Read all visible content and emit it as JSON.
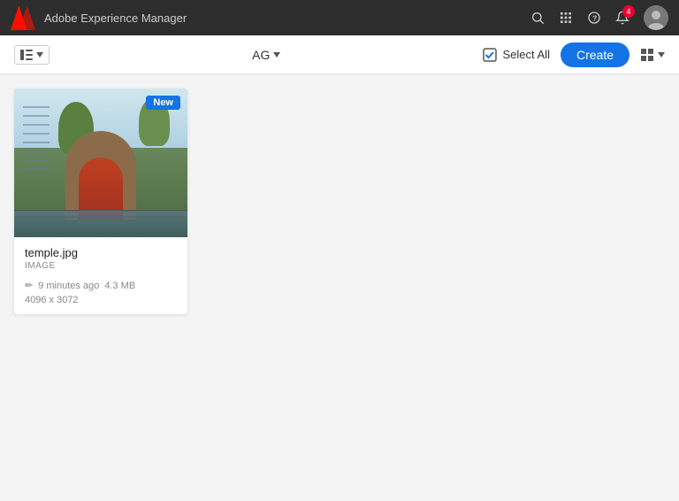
{
  "app": {
    "title": "Adobe Experience Manager",
    "logo_text": "A"
  },
  "nav": {
    "search_title": "Search",
    "grid_title": "Apps",
    "help_title": "Help",
    "notification_count": "4",
    "avatar_label": "User"
  },
  "toolbar": {
    "panel_toggle_label": "Panel",
    "ag_label": "AG",
    "select_all_label": "Select All",
    "create_label": "Create",
    "view_mode": "Grid"
  },
  "assets": [
    {
      "name": "temple.jpg",
      "type": "IMAGE",
      "badge": "New",
      "modified": "9 minutes ago",
      "size": "4.3 MB",
      "dimensions": "4096 x 3072"
    }
  ]
}
